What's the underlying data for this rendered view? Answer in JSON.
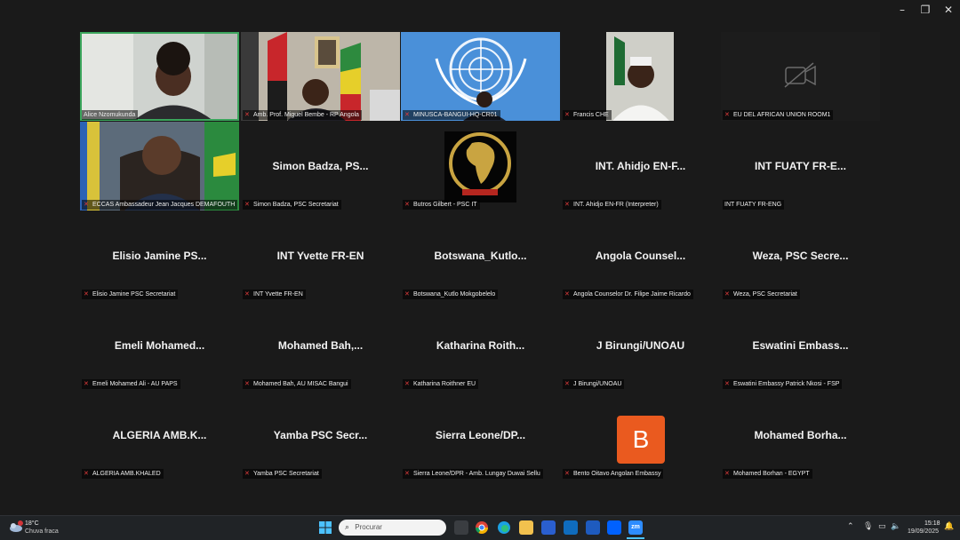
{
  "window": {
    "minimize_icon": "–",
    "restore_icon": "❐",
    "close_icon": "✕"
  },
  "tiles": [
    {
      "label": "Alice Nzomukunda",
      "video": "person-office",
      "muted": false
    },
    {
      "label": "Amb. Prof. Miguel Bembe - RP Angola",
      "video": "flags-office",
      "muted": true
    },
    {
      "label": "MINUSCA-BANGUI-HQ-CR01",
      "video": "un-emblem",
      "muted": true
    },
    {
      "label": "Francis CHE",
      "video": "person-white",
      "muted": true
    },
    {
      "label": "EU DEL AFRICAN UNION ROOM1",
      "video": "camera-off",
      "muted": true
    },
    {
      "label": "ECCAS Ambassadeur Jean Jacques DEMAFOUTH",
      "video": "person-flags",
      "muted": true
    },
    {
      "label": "Simon Badza, PSC Secretariat",
      "big": "Simon Badza, PS...",
      "muted": true
    },
    {
      "label": "Butros Gilbert - PSC IT",
      "video": "au-emblem",
      "muted": true
    },
    {
      "label": "INT. Ahidjo EN-FR (Interpreter)",
      "big": "INT. Ahidjo EN-F...",
      "muted": true
    },
    {
      "label": "INT FUATY FR-ENG",
      "big": "INT FUATY FR-E...",
      "muted": false
    },
    {
      "label": "Elisio Jamine PSC Secretariat",
      "big": "Elisio Jamine PS...",
      "muted": true
    },
    {
      "label": "INT Yvette FR-EN",
      "big": "INT Yvette FR-EN",
      "muted": true
    },
    {
      "label": "Botswana_Kutlo Mokgobelelo",
      "big": "Botswana_Kutlo...",
      "muted": true
    },
    {
      "label": "Angola Counselor Dr. Filipe Jaime Ricardo",
      "big": "Angola Counsel...",
      "muted": true
    },
    {
      "label": "Weza, PSC Secretariat",
      "big": "Weza, PSC Secre...",
      "muted": true
    },
    {
      "label": "Emeli Mohamed Ali - AU PAPS",
      "big": "Emeli Mohamed...",
      "muted": true
    },
    {
      "label": "Mohamed Bah, AU MISAC Bangui",
      "big": "Mohamed Bah,...",
      "muted": true
    },
    {
      "label": "Katharina Roithner EU",
      "big": "Katharina Roith...",
      "muted": true
    },
    {
      "label": "J Birungi/UNOAU",
      "big": "J Birungi/UNOAU",
      "muted": true
    },
    {
      "label": "Eswatini Embassy Patrick Nkosi - FSP",
      "big": "Eswatini Embass...",
      "muted": true
    },
    {
      "label": "ALGERIA AMB.KHALED",
      "big": "ALGERIA AMB.K...",
      "muted": true
    },
    {
      "label": "Yamba PSC Secretariat",
      "big": "Yamba PSC Secr...",
      "muted": true
    },
    {
      "label": "Sierra Leone/DPR - Amb. Lungay Duwai Sellu",
      "big": "Sierra Leone/DP...",
      "muted": true
    },
    {
      "label": "Bento Oitavo Angolan Embassy",
      "avatar": "B",
      "muted": true
    },
    {
      "label": "Mohamed Borhan - EGYPT",
      "big": "Mohamed Borha...",
      "muted": true
    }
  ],
  "taskbar": {
    "weather_temp": "18°C",
    "weather_desc": "Chuva fraca",
    "search_placeholder": "Procurar",
    "time": "15:18",
    "date": "19/09/2025",
    "zoom_label": "zm"
  },
  "colors": {
    "background": "#1a1a1a",
    "active_speaker": "#3ba55c",
    "avatar": "#ea5a1f",
    "mute": "#e23b3b"
  }
}
